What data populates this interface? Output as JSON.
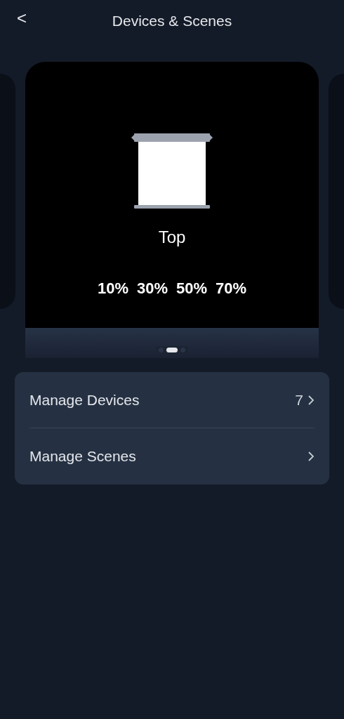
{
  "header": {
    "back": "<",
    "title": "Devices & Scenes"
  },
  "scene_card": {
    "kind": "picture-shade",
    "label": "Top",
    "presets": [
      "10%",
      "30%",
      "50%",
      "70%"
    ]
  },
  "pager": [
    {
      "selected": false
    },
    {
      "selected": true
    },
    {
      "selected": false
    }
  ],
  "menu": [
    {
      "label": "Manage Devices",
      "count": "7"
    },
    {
      "label": "Manage Scenes"
    }
  ]
}
